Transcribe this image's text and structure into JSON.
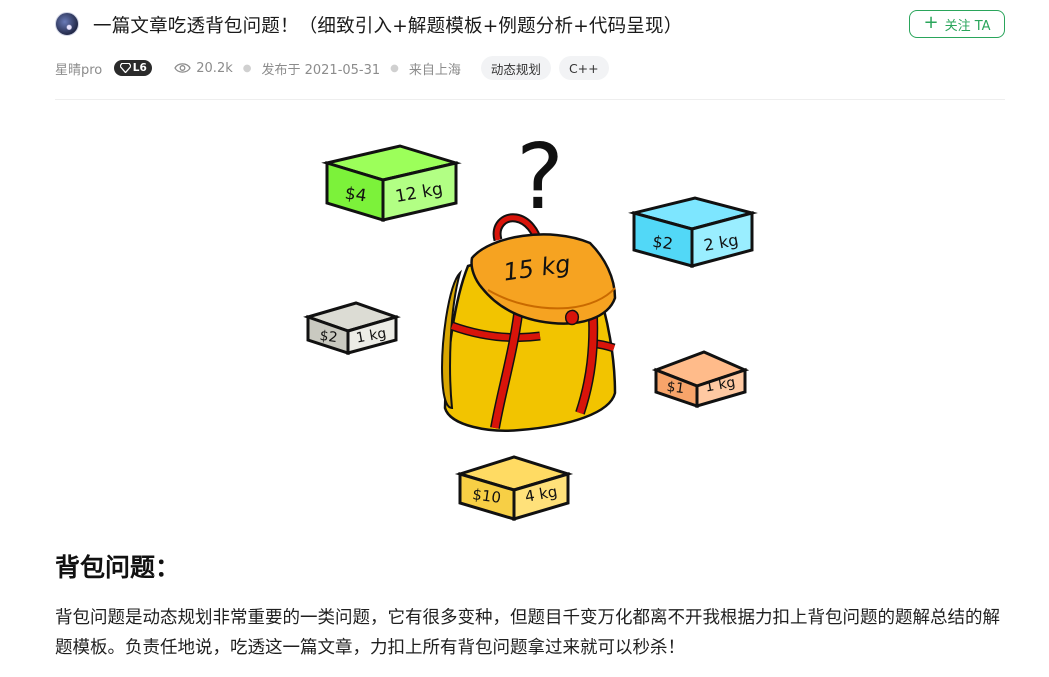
{
  "article": {
    "title": "一篇文章吃透背包问题！（细致引入+解题模板+例题分析+代码呈现）",
    "follow_button": "关注 TA"
  },
  "meta": {
    "author": "星晴pro",
    "level": "L6",
    "views": "20.2k",
    "published": "发布于 2021-05-31",
    "location": "来自上海",
    "tags": [
      "动态规划",
      "C++"
    ]
  },
  "figure": {
    "question_mark": "?",
    "backpack_label": "15 kg",
    "items": [
      {
        "price": "$4",
        "weight": "12 kg",
        "color": "#7cf23a"
      },
      {
        "price": "$2",
        "weight": "2 kg",
        "color": "#52d8f7"
      },
      {
        "price": "$2",
        "weight": "1 kg",
        "color": "#c9c9c0"
      },
      {
        "price": "$1",
        "weight": "1 kg",
        "color": "#f7a46a"
      },
      {
        "price": "$10",
        "weight": "4 kg",
        "color": "#f7cf45"
      }
    ]
  },
  "content": {
    "heading": "背包问题：",
    "paragraph": "背包问题是动态规划非常重要的一类问题，它有很多变种，但题目千变万化都离不开我根据力扣上背包问题的题解总结的解题模板。负责任地说，吃透这一篇文章，力扣上所有背包问题拿过来就可以秒杀！"
  }
}
